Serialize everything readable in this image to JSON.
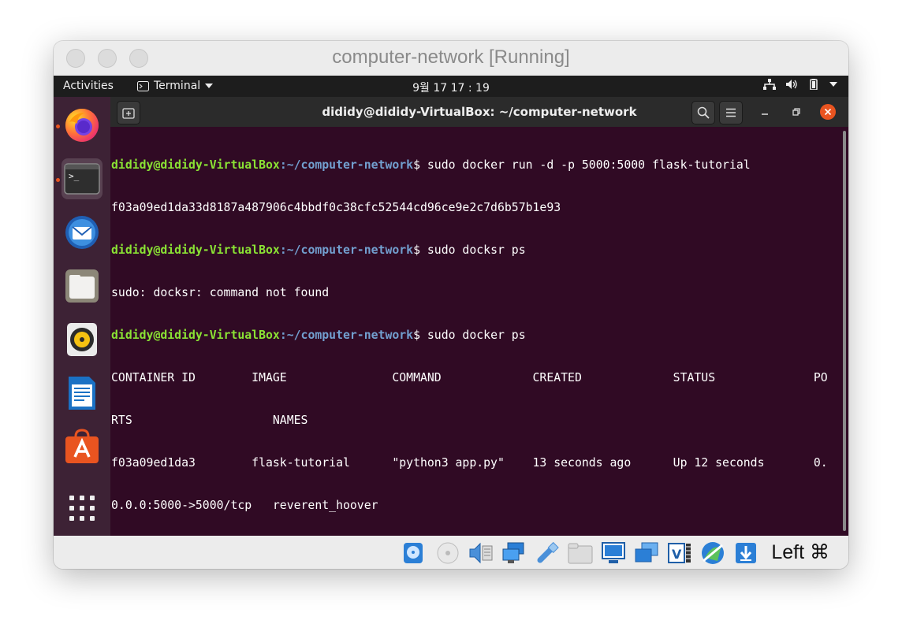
{
  "window": {
    "title": "computer-network [Running]"
  },
  "topbar": {
    "activities": "Activities",
    "app_menu": "Terminal",
    "clock": "9월 17  17 : 19"
  },
  "dock": {
    "items": [
      "firefox-icon",
      "terminal-icon",
      "thunderbird-icon",
      "files-icon",
      "rhythmbox-icon",
      "writer-icon",
      "software-icon",
      "apps-grid-icon"
    ]
  },
  "terminal": {
    "title": "dididy@dididy-VirtualBox: ~/computer-network",
    "prompt_user": "dididy@dididy-VirtualBox",
    "prompt_path": ":~/computer-network",
    "lines": [
      {
        "type": "prompt",
        "cmd": "$ sudo docker run -d -p 5000:5000 flask-tutorial"
      },
      {
        "type": "output",
        "text": "f03a09ed1da33d8187a487906c4bbdf0c38cfc52544cd96ce9e2c7d6b57b1e93"
      },
      {
        "type": "prompt",
        "cmd": "$ sudo docksr ps"
      },
      {
        "type": "output",
        "text": "sudo: docksr: command not found"
      },
      {
        "type": "prompt",
        "cmd": "$ sudo docker ps"
      },
      {
        "type": "output",
        "text": "CONTAINER ID        IMAGE               COMMAND             CREATED             STATUS              PO"
      },
      {
        "type": "output",
        "text": "RTS                    NAMES"
      },
      {
        "type": "output",
        "text": "f03a09ed1da3        flask-tutorial      \"python3 app.py\"    13 seconds ago      Up 12 seconds       0."
      },
      {
        "type": "output",
        "text": "0.0.0:5000->5000/tcp   reverent_hoover"
      },
      {
        "type": "prompt",
        "cmd": "$ ",
        "cursor": true
      }
    ]
  },
  "statusbar": {
    "host_key": "Left ⌘"
  }
}
